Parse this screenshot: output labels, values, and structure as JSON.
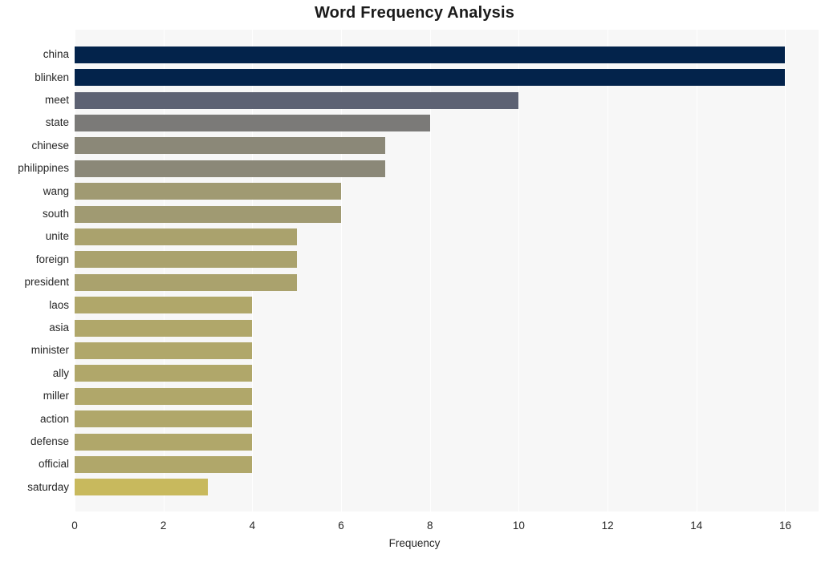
{
  "chart_data": {
    "type": "bar",
    "orientation": "horizontal",
    "title": "Word Frequency Analysis",
    "xlabel": "Frequency",
    "ylabel": "",
    "xlim": [
      0,
      16.75
    ],
    "xticks": [
      0,
      2,
      4,
      6,
      8,
      10,
      12,
      14,
      16
    ],
    "xtick_labels": [
      "0",
      "2",
      "4",
      "6",
      "8",
      "10",
      "12",
      "14",
      "16"
    ],
    "grid": "vertical-white",
    "legend": "none",
    "plot_background": "#f7f7f7",
    "figure_background": "#ffffff",
    "categories": [
      "china",
      "blinken",
      "meet",
      "state",
      "chinese",
      "philippines",
      "wang",
      "south",
      "unite",
      "foreign",
      "president",
      "laos",
      "asia",
      "minister",
      "ally",
      "miller",
      "action",
      "defense",
      "official",
      "saturday"
    ],
    "values": [
      16,
      16,
      10,
      8,
      7,
      7,
      6,
      6,
      5,
      5,
      5,
      4,
      4,
      4,
      4,
      4,
      4,
      4,
      4,
      3
    ],
    "bar_colors": [
      "#03234b",
      "#03234b",
      "#5d6273",
      "#7b7a78",
      "#8b8878",
      "#8b8878",
      "#a09a72",
      "#a09a72",
      "#aaa26d",
      "#aaa26d",
      "#aaa26d",
      "#b0a76a",
      "#b0a76a",
      "#b0a76a",
      "#b0a76a",
      "#b0a76a",
      "#b0a76a",
      "#b0a76a",
      "#b0a76a",
      "#c8b95d"
    ]
  }
}
